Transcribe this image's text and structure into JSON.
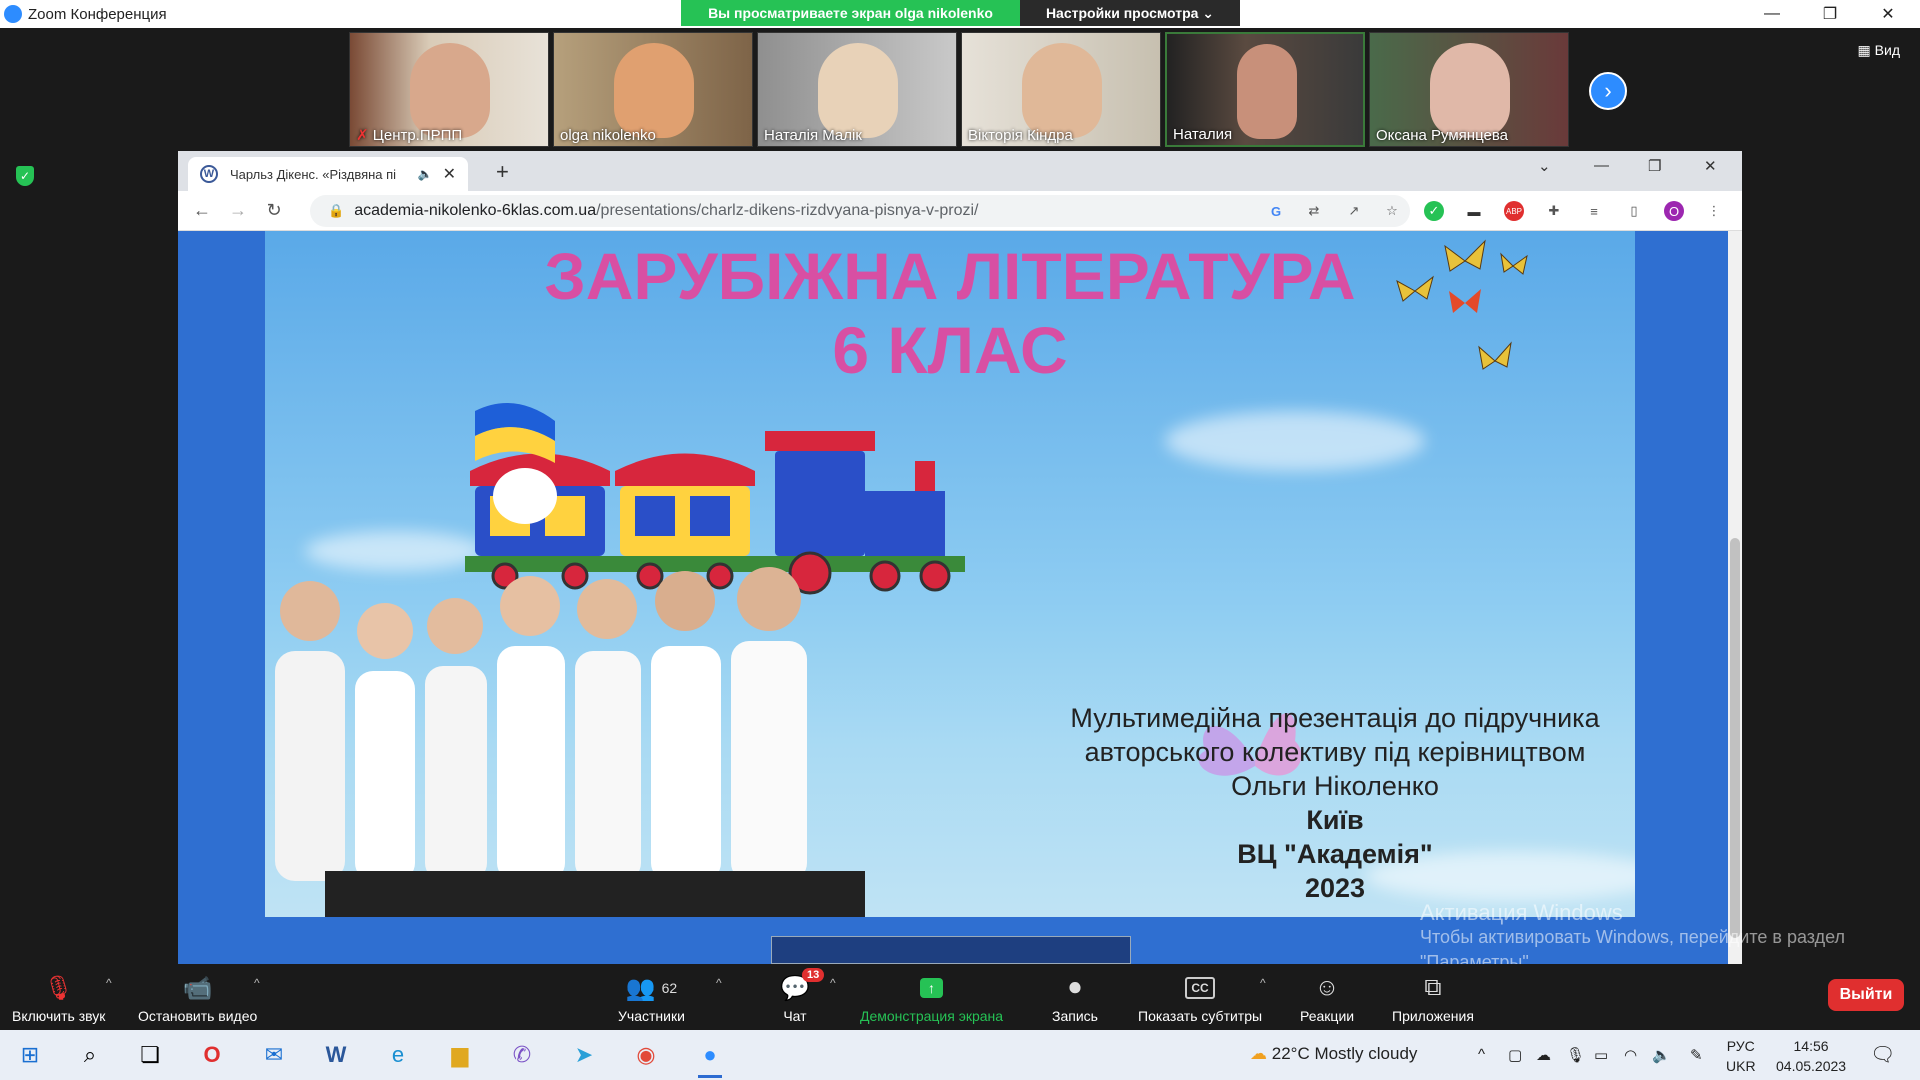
{
  "zoom": {
    "title": "Zoom Конференция",
    "share_banner": "Вы просматриваете экран olga nikolenko",
    "view_settings": "Настройки просмотра ⌄",
    "view_label": "Вид",
    "participants": [
      {
        "name": "Центр.ПРПП",
        "muted": true
      },
      {
        "name": "olga nikolenko",
        "muted": false
      },
      {
        "name": "Наталія Малік",
        "muted": false
      },
      {
        "name": "Вікторія Кіндра",
        "muted": false
      },
      {
        "name": "Наталия",
        "muted": false
      },
      {
        "name": "Оксана Румянцева",
        "muted": false
      }
    ]
  },
  "browser": {
    "tab_title": "Чарльз Дікенс. «Різдвяна пі",
    "url_host": "academia-nikolenko-6klas.com.ua",
    "url_path": "/presentations/charlz-dikens-rizdvyana-pisnya-v-prozi/"
  },
  "slide": {
    "title_line1": "ЗАРУБІЖНА ЛІТЕРАТУРА",
    "title_line2": "6 КЛАС",
    "desc_line1": "Мультимедійна презентація до підручника",
    "desc_line2": "авторського колективу під керівництвом",
    "desc_line3": "Ольги Ніколенко",
    "city": "Київ",
    "publisher": "ВЦ \"Академія\"",
    "year": "2023"
  },
  "watermark": {
    "line1": "Активация Windows",
    "line2": "Чтобы активировать Windows, перейдите в раздел",
    "line3": "\"Параметры\"."
  },
  "toolbar": {
    "audio": "Включить звук",
    "video": "Остановить видео",
    "participants": "Участники",
    "participants_count": "62",
    "chat": "Чат",
    "chat_badge": "13",
    "share": "Демонстрация экрана",
    "record": "Запись",
    "captions": "Показать субтитры",
    "reactions": "Реакции",
    "apps": "Приложения",
    "exit": "Выйти"
  },
  "taskbar": {
    "weather": "22°C  Mostly cloudy",
    "lang1": "РУС",
    "lang2": "UKR",
    "time": "14:56",
    "date": "04.05.2023"
  },
  "colors": {
    "zoom_green": "#26c255",
    "zoom_blue": "#2d8cff",
    "exit_red": "#e02f2f",
    "slide_title_pink": "#d84fa3"
  }
}
